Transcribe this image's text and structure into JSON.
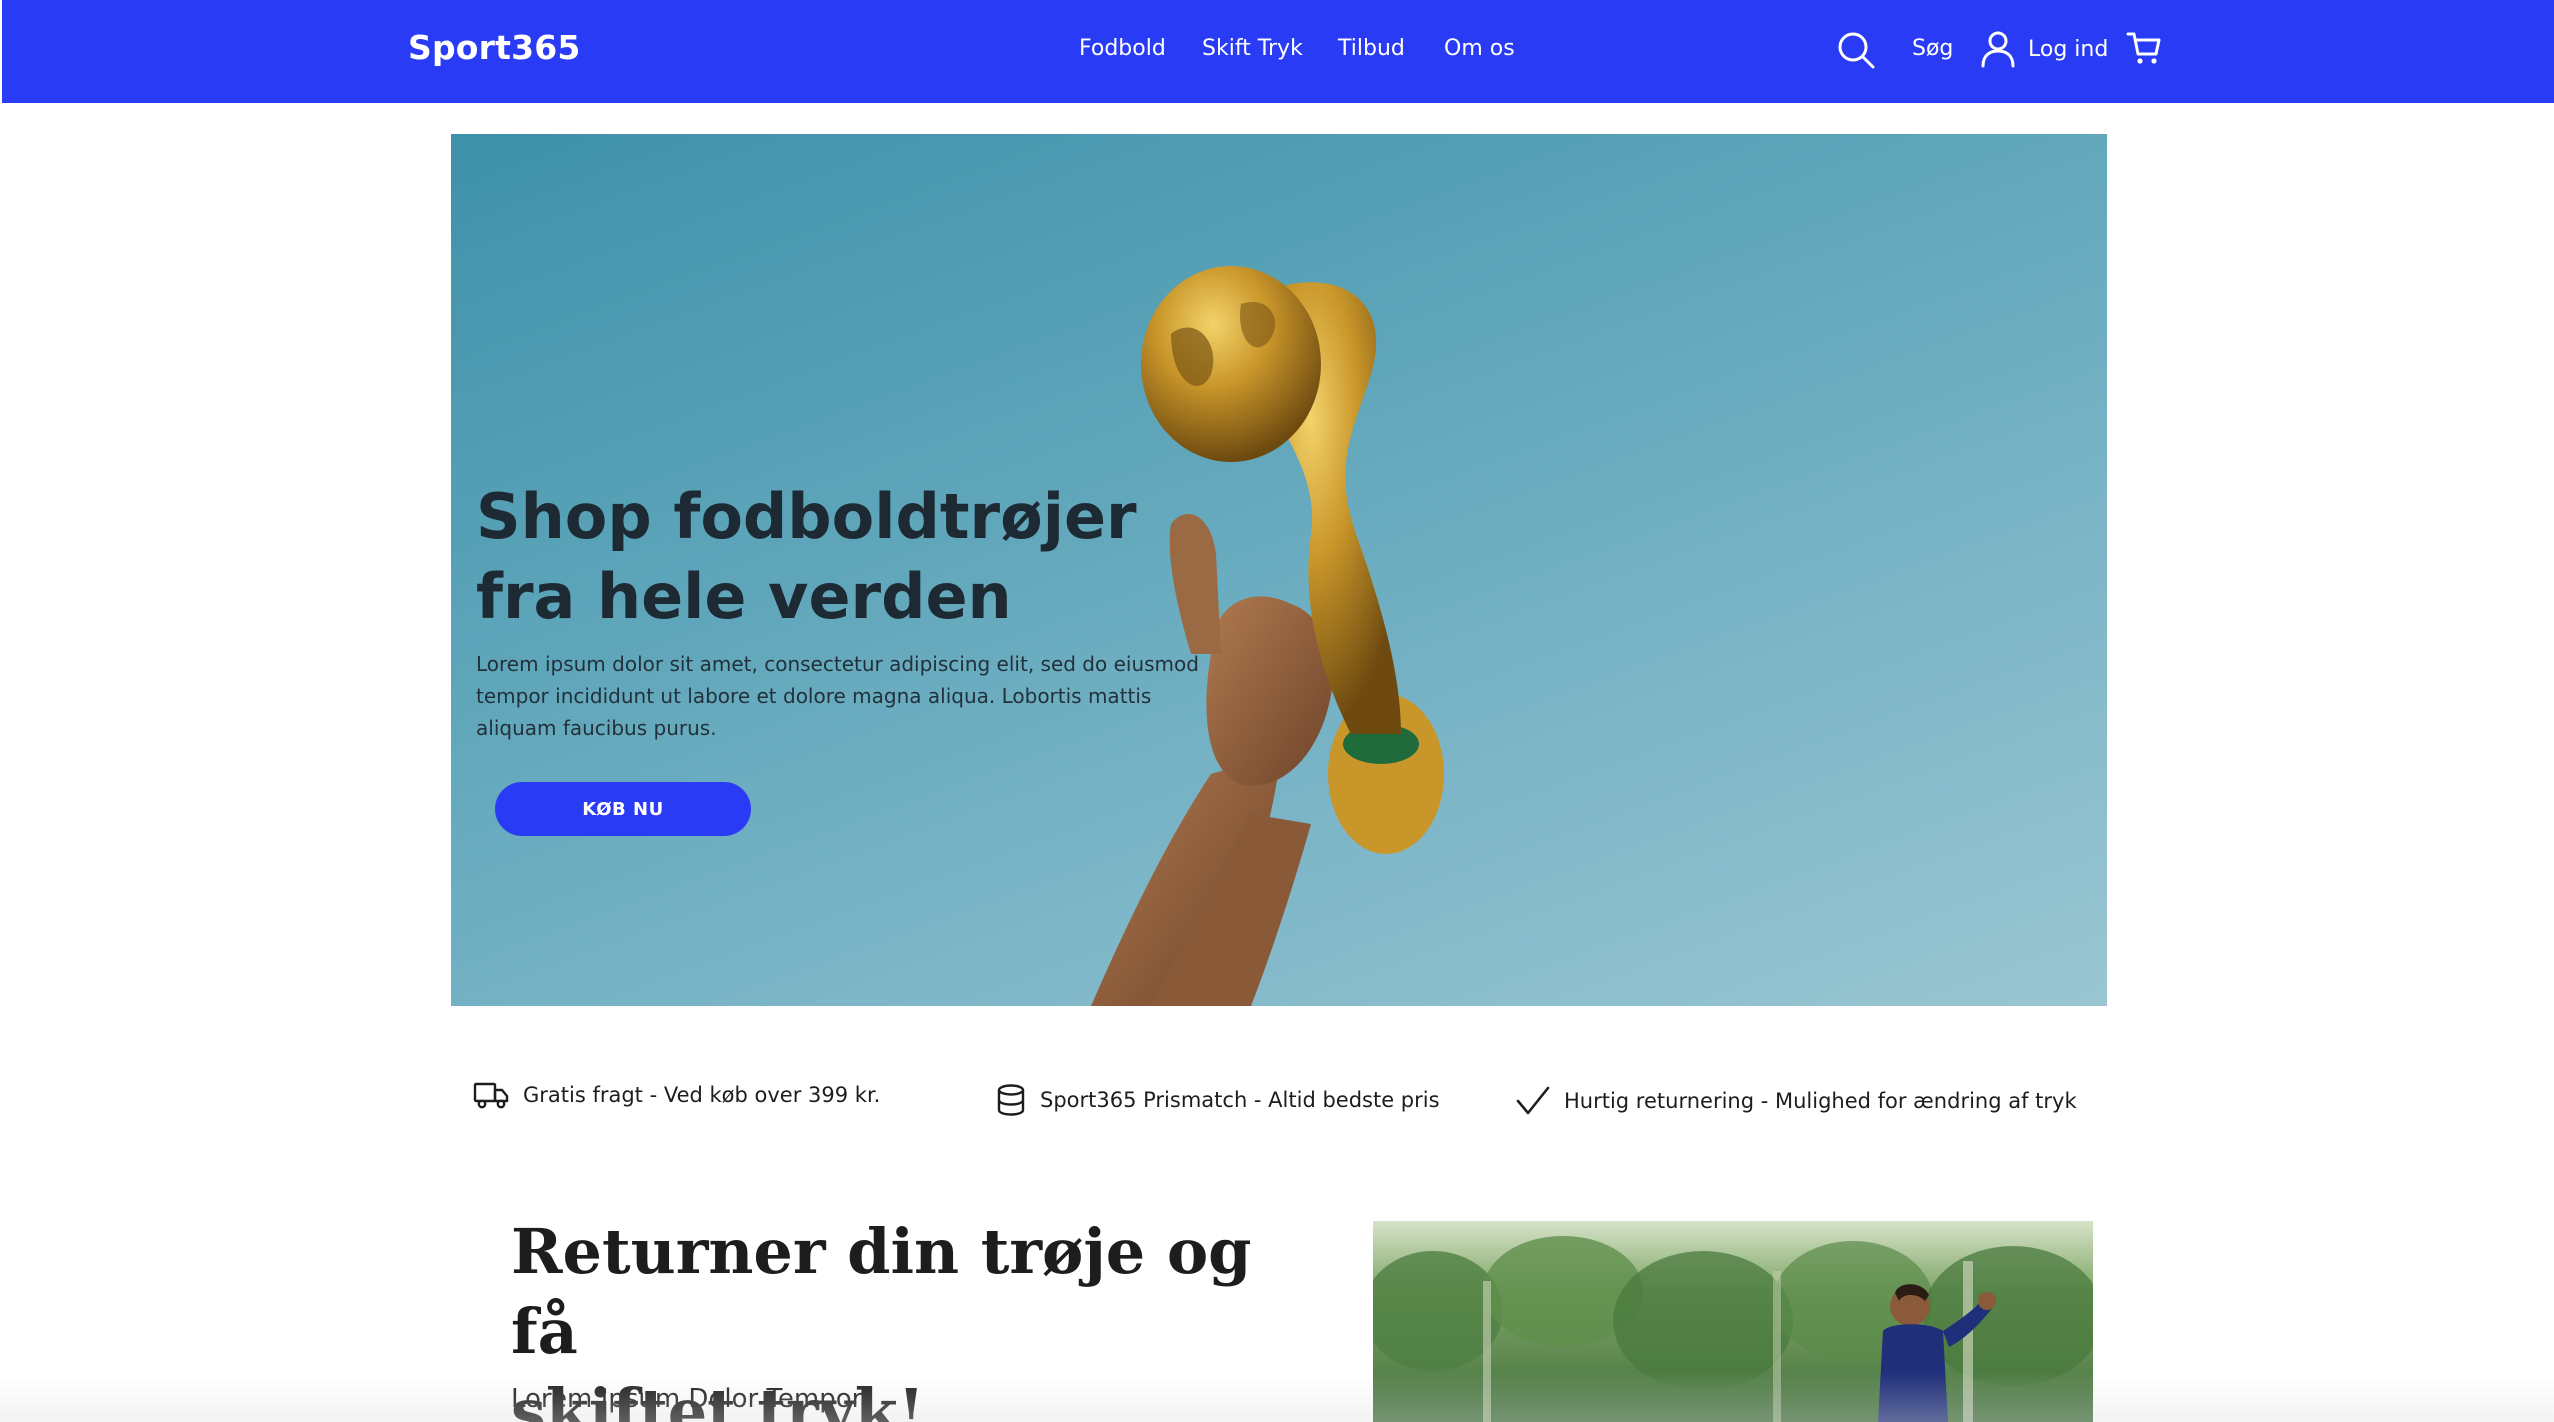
{
  "nav": {
    "logo": "Sport365",
    "links": [
      "Fodbold",
      "Skift Tryk",
      "Tilbud",
      "Om os"
    ],
    "search_label": "Søg",
    "login_label": "Log ind"
  },
  "hero": {
    "title_line1": "Shop fodboldtrøjer",
    "title_line2": "fra hele verden",
    "text": "Lorem ipsum dolor sit amet, consectetur adipiscing elit, sed do eiusmod tempor incididunt ut labore et dolore magna aliqua. Lobortis mattis aliquam faucibus purus.",
    "cta_label": "KØB NU"
  },
  "features": [
    {
      "icon": "truck-icon",
      "text": "Gratis fragt - Ved køb over 399 kr."
    },
    {
      "icon": "database-icon",
      "text": "Sport365 Prismatch - Altid bedste pris"
    },
    {
      "icon": "checkmark-icon",
      "text": "Hurtig returnering - Mulighed for ændring af tryk"
    }
  ],
  "return_section": {
    "title_line1": "Returner din trøje og få",
    "title_line2": "skiftet tryk!",
    "subtitle": "Lorem Ipsum Dolor Tempor"
  },
  "colors": {
    "brand_blue": "#2a3bf5",
    "hero_sky": "#5ca4b9",
    "trophy_gold": "#c9a227"
  }
}
